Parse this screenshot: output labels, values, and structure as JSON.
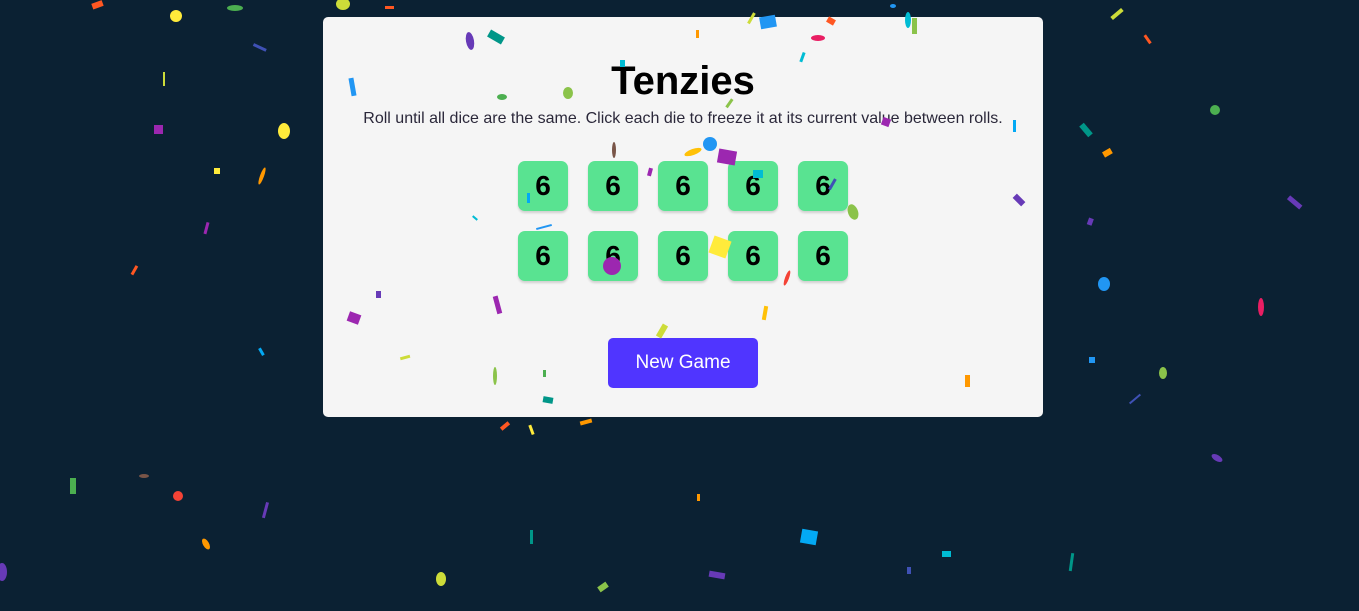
{
  "game": {
    "title": "Tenzies",
    "instructions": "Roll until all dice are the same. Click each die to freeze it at its current value between rolls.",
    "dice": [
      {
        "value": "6",
        "held": true
      },
      {
        "value": "6",
        "held": true
      },
      {
        "value": "6",
        "held": true
      },
      {
        "value": "6",
        "held": true
      },
      {
        "value": "6",
        "held": true
      },
      {
        "value": "6",
        "held": true
      },
      {
        "value": "6",
        "held": true
      },
      {
        "value": "6",
        "held": true
      },
      {
        "value": "6",
        "held": true
      },
      {
        "value": "6",
        "held": true
      }
    ],
    "button_label": "New Game"
  },
  "colors": {
    "background": "#0b2133",
    "board": "#f5f5f5",
    "held_die": "#59e391",
    "button": "#5035ff",
    "confetti": [
      "#e91e63",
      "#9c27b0",
      "#673ab7",
      "#3f51b5",
      "#2196f3",
      "#03a9f4",
      "#00bcd4",
      "#009688",
      "#4caf50",
      "#8bc34a",
      "#cddc39",
      "#ffeb3b",
      "#ffc107",
      "#ff9800",
      "#ff5722",
      "#795548"
    ]
  }
}
